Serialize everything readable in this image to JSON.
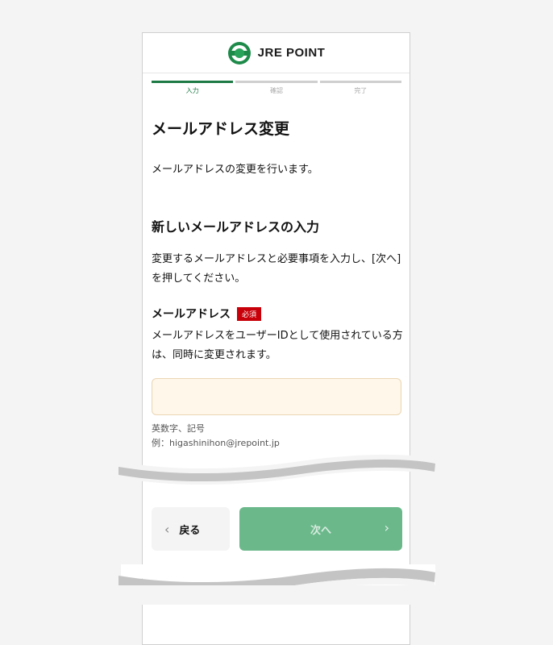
{
  "header": {
    "brand": "JRE POINT"
  },
  "steps": [
    {
      "label": "入力",
      "active": true
    },
    {
      "label": "確認",
      "active": false
    },
    {
      "label": "完了",
      "active": false
    }
  ],
  "page": {
    "title": "メールアドレス変更",
    "intro": "メールアドレスの変更を行います。"
  },
  "section": {
    "title": "新しいメールアドレスの入力",
    "description": "変更するメールアドレスと必要事項を入力し、[次へ]を押してください。"
  },
  "field": {
    "label": "メールアドレス",
    "required": "必須",
    "note": "メールアドレスをユーザーIDとして使用されている方は、同時に変更されます。",
    "value": "",
    "hint_line1": "英数字、記号",
    "hint_line2": "例：higashinihon@jrepoint.jp"
  },
  "buttons": {
    "back": "戻る",
    "next": "次へ"
  },
  "colors": {
    "accent": "#1e7a44",
    "required": "#c8000a",
    "next_button": "#6bb88b",
    "input_bg": "#fff7ea"
  }
}
